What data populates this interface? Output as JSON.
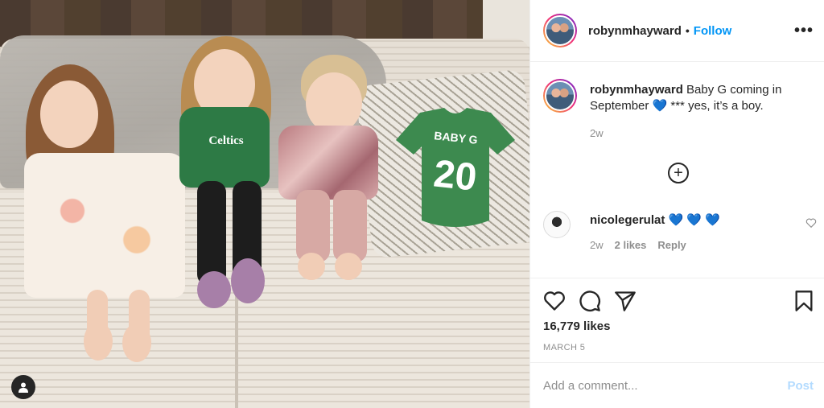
{
  "post": {
    "username": "robynmhayward",
    "follow_label": "Follow",
    "separator": "•",
    "more_label": "•••"
  },
  "caption": {
    "username": "robynmhayward",
    "text": "Baby G coming in September 💙  *** yes, it’s a boy.",
    "time": "2w"
  },
  "load_more_label": "+",
  "comments": [
    {
      "username": "nicolegerulat",
      "text": "💙 💙 💙",
      "time": "2w",
      "likes": "2 likes",
      "reply_label": "Reply"
    }
  ],
  "stats": {
    "likes": "16,779 likes",
    "date": "MARCH 5"
  },
  "add_comment": {
    "placeholder": "Add a comment...",
    "post_label": "Post"
  },
  "photo": {
    "jersey_line1": "BABY G",
    "jersey_line2": "20",
    "shirt_text": "Celtics"
  },
  "icons": {
    "like": "heart-icon",
    "comment": "comment-icon",
    "share": "paper-plane-icon",
    "save": "bookmark-icon",
    "more": "more-icon",
    "add": "plus-circle-icon",
    "user_tag": "user-tag-icon"
  },
  "colors": {
    "link": "#0095f6",
    "post_disabled": "#b3dbff",
    "muted": "#8e8e8e",
    "text": "#262626",
    "heart_emoji": "#1e6fd9",
    "jersey": "#3d8a4f"
  }
}
